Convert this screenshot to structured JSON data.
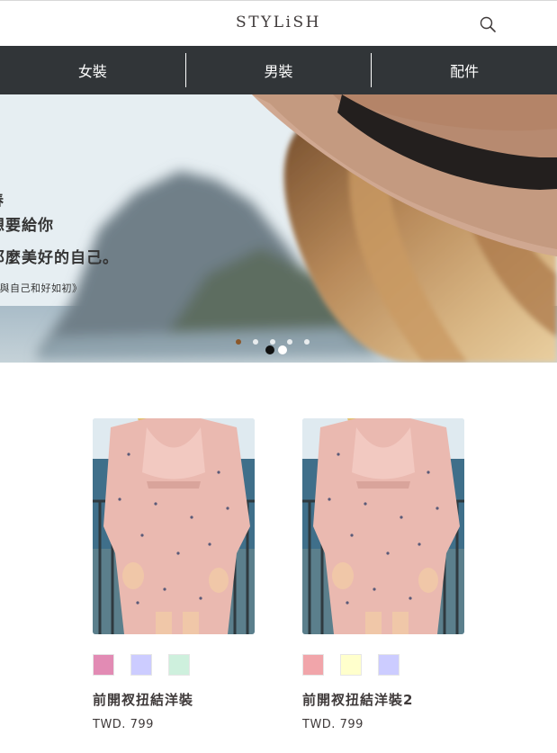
{
  "header": {
    "logo": "STYLiSH",
    "search_icon": "search-icon"
  },
  "nav": {
    "items": [
      {
        "label": "女裝"
      },
      {
        "label": "男裝"
      },
      {
        "label": "配件"
      }
    ]
  },
  "hero": {
    "lines": [
      "春",
      "想要給你",
      "那麼美好的自己。",
      "《與自己和好如初》"
    ],
    "dot_count": 2,
    "active_dot": 0
  },
  "products": [
    {
      "name": "前開衩扭結洋裝",
      "price": "TWD. 799",
      "colors": [
        "#e28bb4",
        "#ccccff",
        "#cef0dd"
      ]
    },
    {
      "name": "前開衩扭結洋裝2",
      "price": "TWD. 799",
      "colors": [
        "#f1a5aa",
        "#ffffcc",
        "#ccccff"
      ]
    }
  ],
  "colors": {
    "nav_bg": "#313538",
    "text": "#3f3a3a"
  }
}
